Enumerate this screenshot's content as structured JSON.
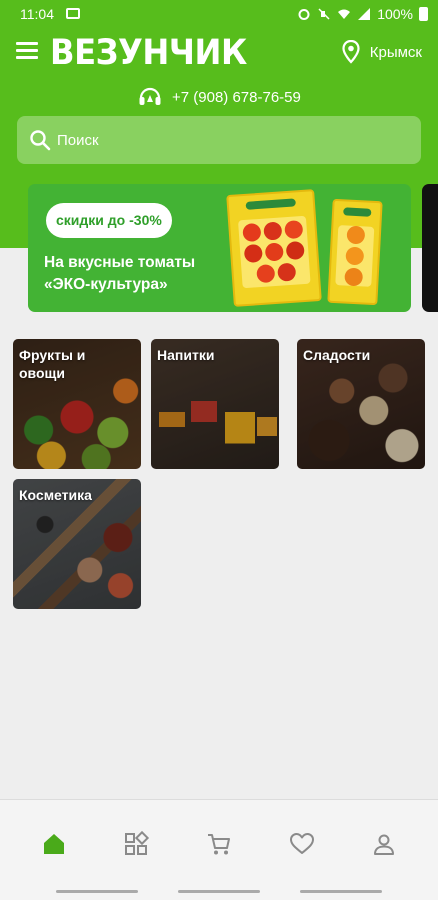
{
  "status": {
    "time": "11:04",
    "battery": "100%"
  },
  "header": {
    "logo": "ВЕЗУНЧИК",
    "city": "Крымск",
    "phone": "+7 (908) 678-76-59",
    "search_placeholder": "Поиск",
    "colors": {
      "brand_green": "#57bd1c",
      "banner_green": "#43b334"
    }
  },
  "banner": {
    "pill": "скидки до -30%",
    "text_line1": "На вкусные томаты",
    "text_line2": "«ЭКО-культура»"
  },
  "categories": [
    {
      "title_line1": "Фрукты и",
      "title_line2": "овощи"
    },
    {
      "title_line1": "Напитки",
      "title_line2": ""
    },
    {
      "title_line1": "Сладости",
      "title_line2": ""
    },
    {
      "title_line1": "Косметика",
      "title_line2": ""
    }
  ],
  "nav": {
    "items": [
      "home-icon",
      "catalog-icon",
      "cart-icon",
      "favorites-icon",
      "profile-icon"
    ],
    "active_color": "#4aaa1a",
    "inactive_color": "#8a8a8a"
  }
}
